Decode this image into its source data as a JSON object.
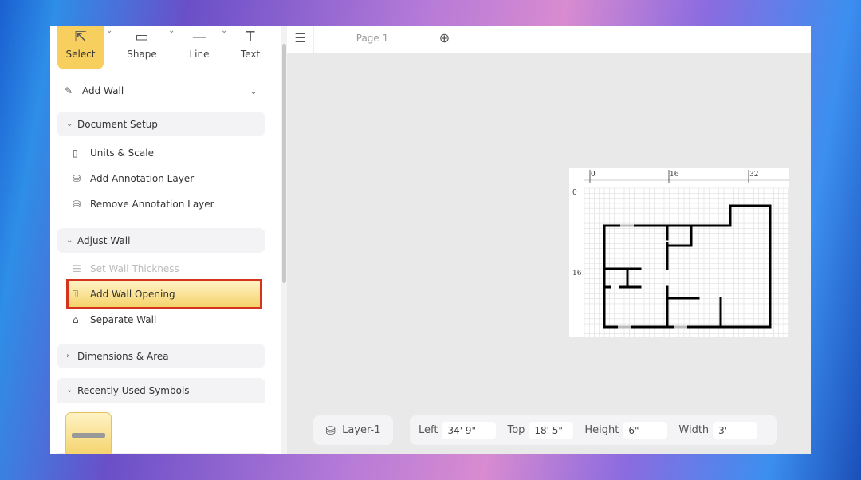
{
  "toolbar": {
    "tools": [
      {
        "label": "Select",
        "icon": "cursor-icon",
        "selected": true
      },
      {
        "label": "Shape",
        "icon": "rectangle-icon"
      },
      {
        "label": "Line",
        "icon": "line-icon"
      },
      {
        "label": "Text",
        "icon": "text-icon"
      }
    ]
  },
  "sidebar": {
    "add_wall": "Add Wall",
    "sections": [
      {
        "label": "Document Setup",
        "expanded": true,
        "items": [
          "Units & Scale",
          "Add Annotation Layer",
          "Remove Annotation Layer"
        ]
      },
      {
        "label": "Adjust Wall",
        "expanded": true,
        "items": [
          "Set Wall Thickness",
          "Add Wall Opening",
          "Separate Wall"
        ]
      },
      {
        "label": "Dimensions & Area",
        "expanded": false
      },
      {
        "label": "Recently Used Symbols",
        "expanded": true
      }
    ]
  },
  "tabs": {
    "page": "Page 1"
  },
  "ruler": {
    "x_ticks": [
      "0",
      "16",
      "32"
    ],
    "y_ticks": [
      "0",
      "16"
    ]
  },
  "bottom": {
    "layer": "Layer-1",
    "left_label": "Left",
    "left_value": "34' 9\"",
    "top_label": "Top",
    "top_value": "18' 5\"",
    "height_label": "Height",
    "height_value": "6\"",
    "width_label": "Width",
    "width_value": "3'"
  },
  "colors": {
    "accent": "#f6cf5f",
    "highlight_border": "#d6331f"
  }
}
